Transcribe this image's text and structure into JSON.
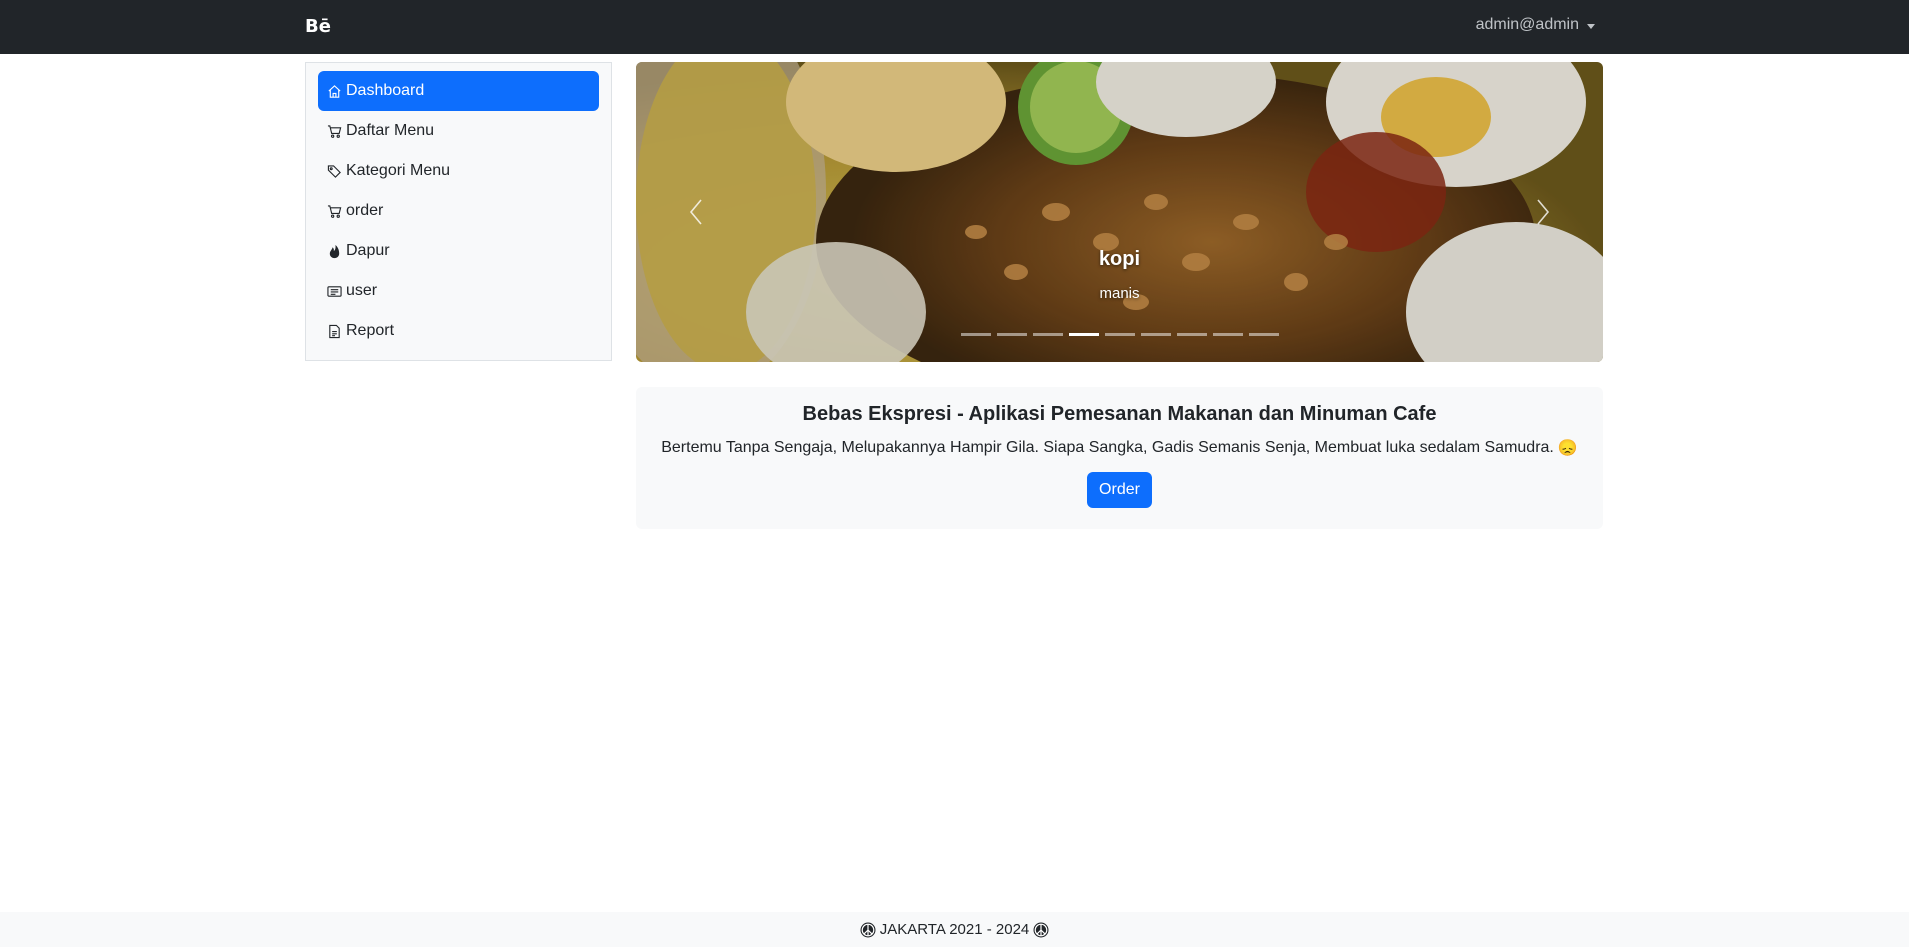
{
  "navbar": {
    "brand": "Bē",
    "user": "admin@admin"
  },
  "sidebar": {
    "items": [
      {
        "label": "Dashboard",
        "icon": "house-icon",
        "active": true
      },
      {
        "label": "Daftar Menu",
        "icon": "cart-icon"
      },
      {
        "label": "Kategori Menu",
        "icon": "tags-icon"
      },
      {
        "label": "order",
        "icon": "cart-icon"
      },
      {
        "label": "Dapur",
        "icon": "fire-icon"
      },
      {
        "label": "user",
        "icon": "person-vcard-icon"
      },
      {
        "label": "Report",
        "icon": "file-earmark-icon"
      }
    ]
  },
  "carousel": {
    "caption_title": "kopi",
    "caption_text": "manis",
    "indicator_count": 9,
    "active_index": 3,
    "image": "food-photo"
  },
  "hero": {
    "title": "Bebas Ekspresi - Aplikasi Pemesanan Makanan dan Minuman Cafe",
    "text": "Bertemu Tanpa Sengaja, Melupakannya Hampir Gila. Siapa Sangka, Gadis Semanis Senja, Membuat luka sedalam Samudra.",
    "emoji": "😞",
    "button": "Order"
  },
  "footer": {
    "text": "JAKARTA 2021 - 2024",
    "icon": "peace-icon"
  },
  "colors": {
    "navbar": "#212529",
    "primary": "#0d6efd",
    "light": "#f8f9fa"
  }
}
